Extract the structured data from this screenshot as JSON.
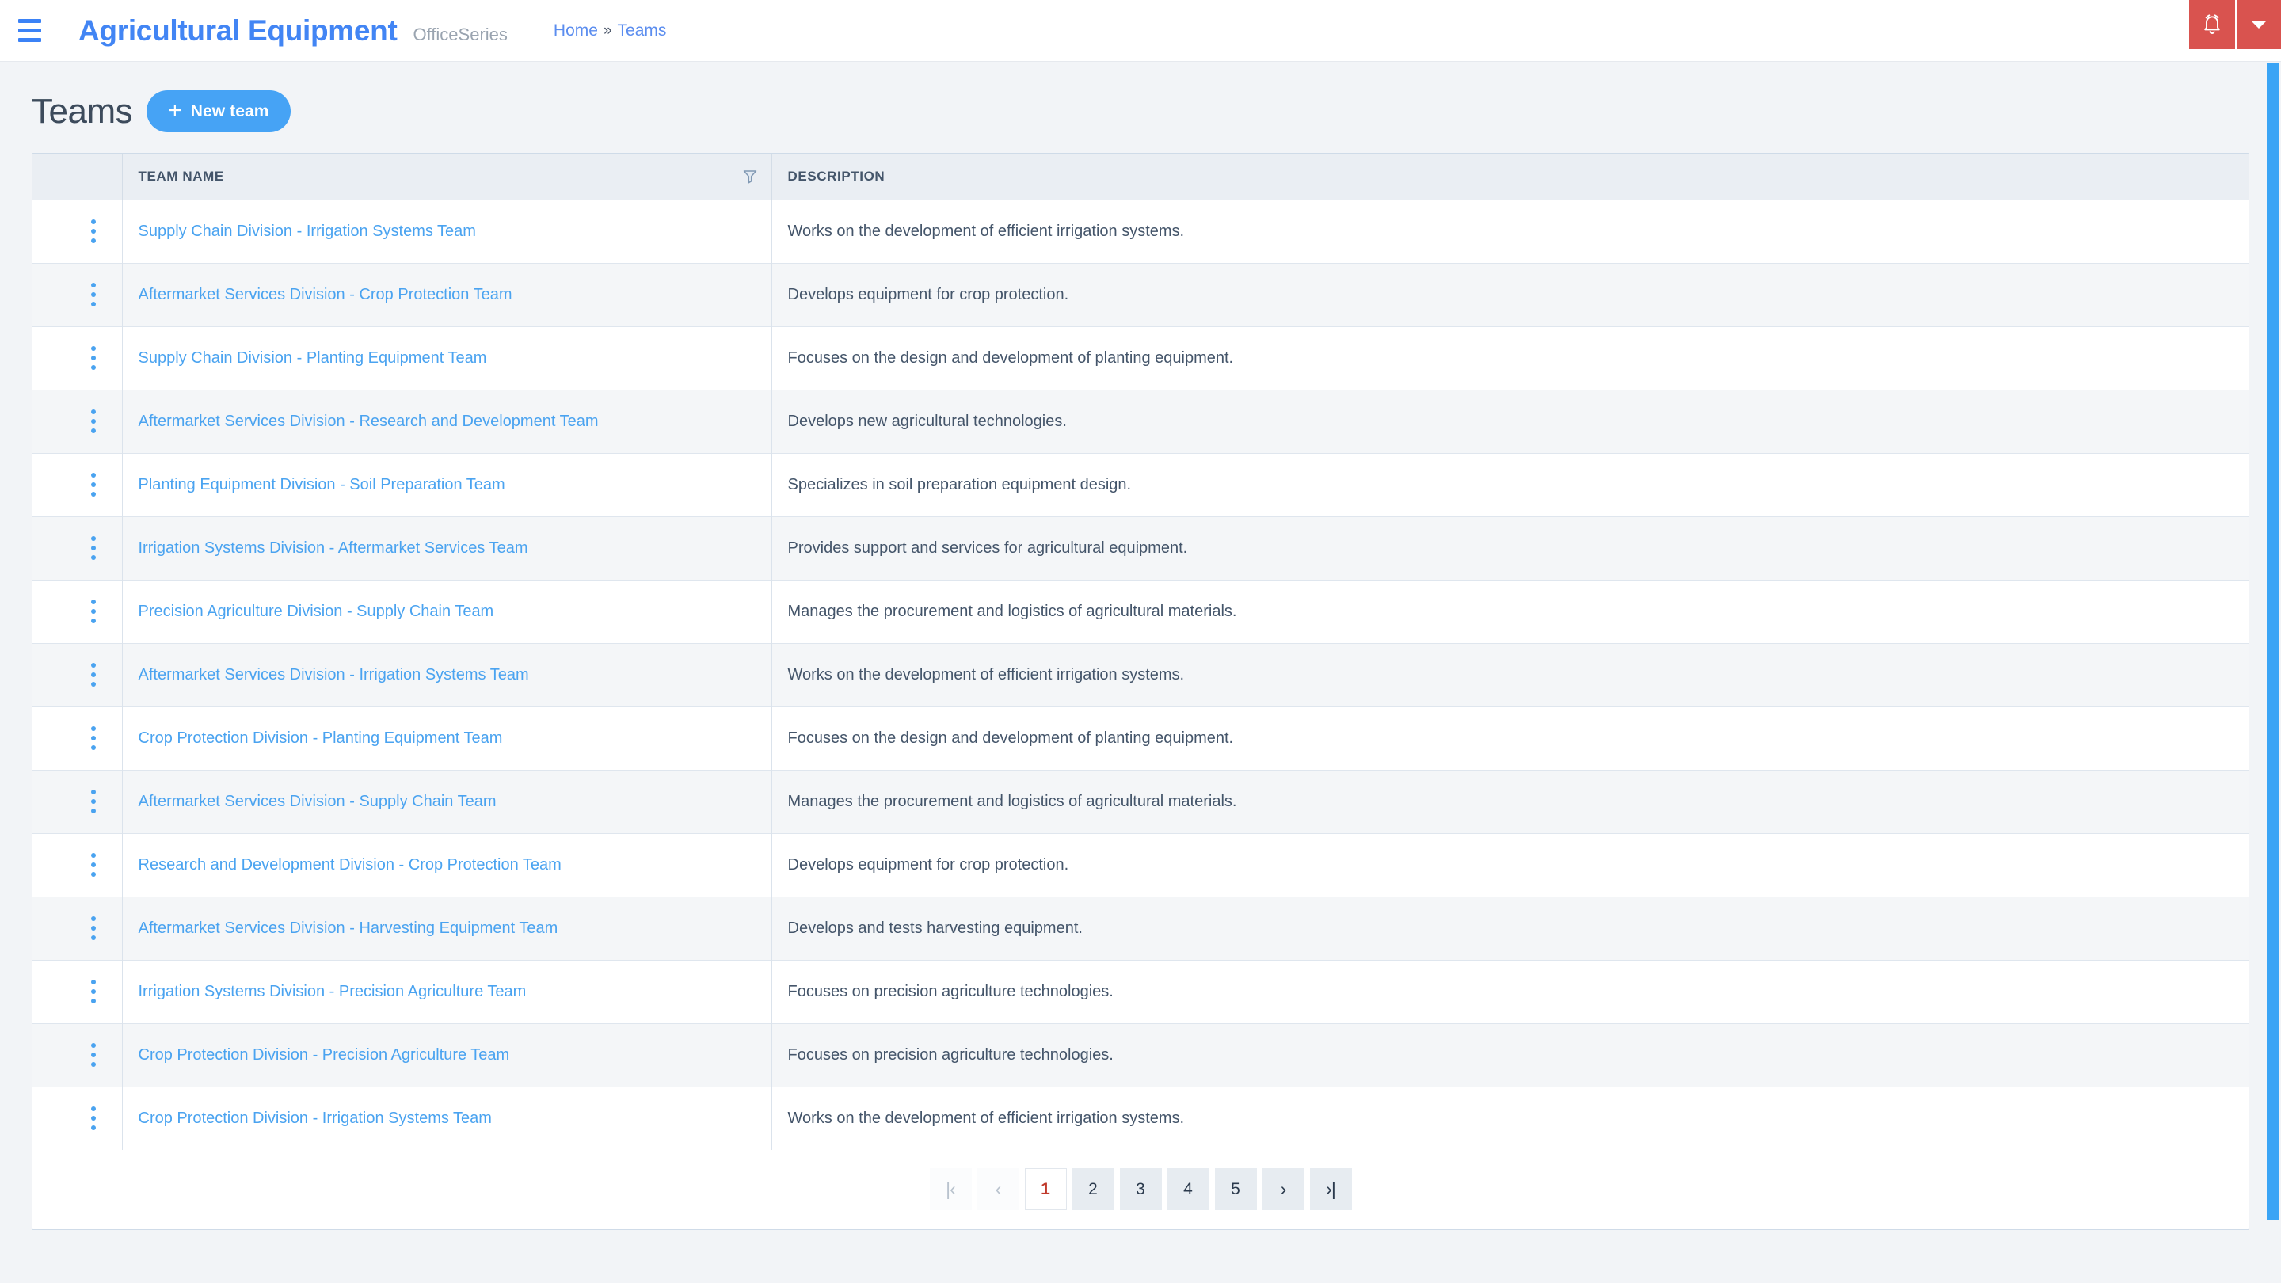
{
  "topbar": {
    "menu_icon": "hamburger-icon",
    "brand_title": "Agricultural Equipment",
    "brand_subtitle": "OfficeSeries",
    "breadcrumb": {
      "home": "Home",
      "separator": "»",
      "current": "Teams"
    },
    "notification_icon": "bell-icon",
    "dropdown_icon": "caret-down-icon",
    "accent_red": "#d9534f",
    "brand_blue": "#4285f4"
  },
  "page": {
    "title": "Teams",
    "new_button_label": "New team",
    "new_button_icon": "plus-icon",
    "new_button_color": "#46a3f5"
  },
  "table": {
    "columns": [
      {
        "key": "actions",
        "label": ""
      },
      {
        "key": "name",
        "label": "TEAM NAME",
        "filter_icon": "filter-funnel-icon"
      },
      {
        "key": "description",
        "label": "DESCRIPTION"
      }
    ],
    "row_menu_icon": "kebab-menu-icon",
    "link_color": "#4aa3f0",
    "rows": [
      {
        "name": "Supply Chain Division - Irrigation Systems Team",
        "description": "Works on the development of efficient irrigation systems."
      },
      {
        "name": "Aftermarket Services Division - Crop Protection Team",
        "description": "Develops equipment for crop protection."
      },
      {
        "name": "Supply Chain Division - Planting Equipment Team",
        "description": "Focuses on the design and development of planting equipment."
      },
      {
        "name": "Aftermarket Services Division - Research and Development Team",
        "description": "Develops new agricultural technologies."
      },
      {
        "name": "Planting Equipment Division - Soil Preparation Team",
        "description": "Specializes in soil preparation equipment design."
      },
      {
        "name": "Irrigation Systems Division - Aftermarket Services Team",
        "description": "Provides support and services for agricultural equipment."
      },
      {
        "name": "Precision Agriculture Division - Supply Chain Team",
        "description": "Manages the procurement and logistics of agricultural materials."
      },
      {
        "name": "Aftermarket Services Division - Irrigation Systems Team",
        "description": "Works on the development of efficient irrigation systems."
      },
      {
        "name": "Crop Protection Division - Planting Equipment Team",
        "description": "Focuses on the design and development of planting equipment."
      },
      {
        "name": "Aftermarket Services Division - Supply Chain Team",
        "description": "Manages the procurement and logistics of agricultural materials."
      },
      {
        "name": "Research and Development Division - Crop Protection Team",
        "description": "Develops equipment for crop protection."
      },
      {
        "name": "Aftermarket Services Division - Harvesting Equipment Team",
        "description": "Develops and tests harvesting equipment."
      },
      {
        "name": "Irrigation Systems Division - Precision Agriculture Team",
        "description": "Focuses on precision agriculture technologies."
      },
      {
        "name": "Crop Protection Division - Precision Agriculture Team",
        "description": "Focuses on precision agriculture technologies."
      },
      {
        "name": "Crop Protection Division - Irrigation Systems Team",
        "description": "Works on the development of efficient irrigation systems."
      }
    ]
  },
  "pagination": {
    "first_label": "|‹",
    "prev_label": "‹",
    "next_label": "›",
    "last_label": "›|",
    "pages": [
      "1",
      "2",
      "3",
      "4",
      "5"
    ],
    "active_page": "1",
    "active_color": "#c0392b"
  },
  "scrollbar": {
    "thumb_color": "#3aa4f5"
  }
}
